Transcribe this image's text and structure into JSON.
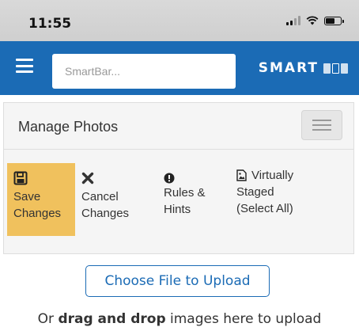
{
  "status_bar": {
    "time": "11:55"
  },
  "header": {
    "menu_icon": "hamburger-icon",
    "search_placeholder": "SmartBar...",
    "brand_text": "SMART"
  },
  "panel": {
    "title": "Manage Photos",
    "toggle_icon": "menu-toggle-icon"
  },
  "toolbar": {
    "save": {
      "icon": "floppy-disk-icon",
      "line1": "Save",
      "line2": "Changes"
    },
    "cancel": {
      "icon": "close-icon",
      "line1": "Cancel",
      "line2": "Changes"
    },
    "rules": {
      "icon": "exclamation-circle-icon",
      "line1": "Rules &",
      "line2": "Hints"
    },
    "virtual": {
      "icon": "image-file-icon",
      "line1": "Virtually",
      "line2": "Staged",
      "line3": "(Select All)"
    }
  },
  "upload": {
    "button_label": "Choose File to Upload",
    "hint_prefix": "Or ",
    "hint_bold": "drag and drop",
    "hint_suffix": " images here to upload"
  },
  "colors": {
    "header_blue": "#1b6bb5",
    "save_highlight": "#f0c15d"
  }
}
